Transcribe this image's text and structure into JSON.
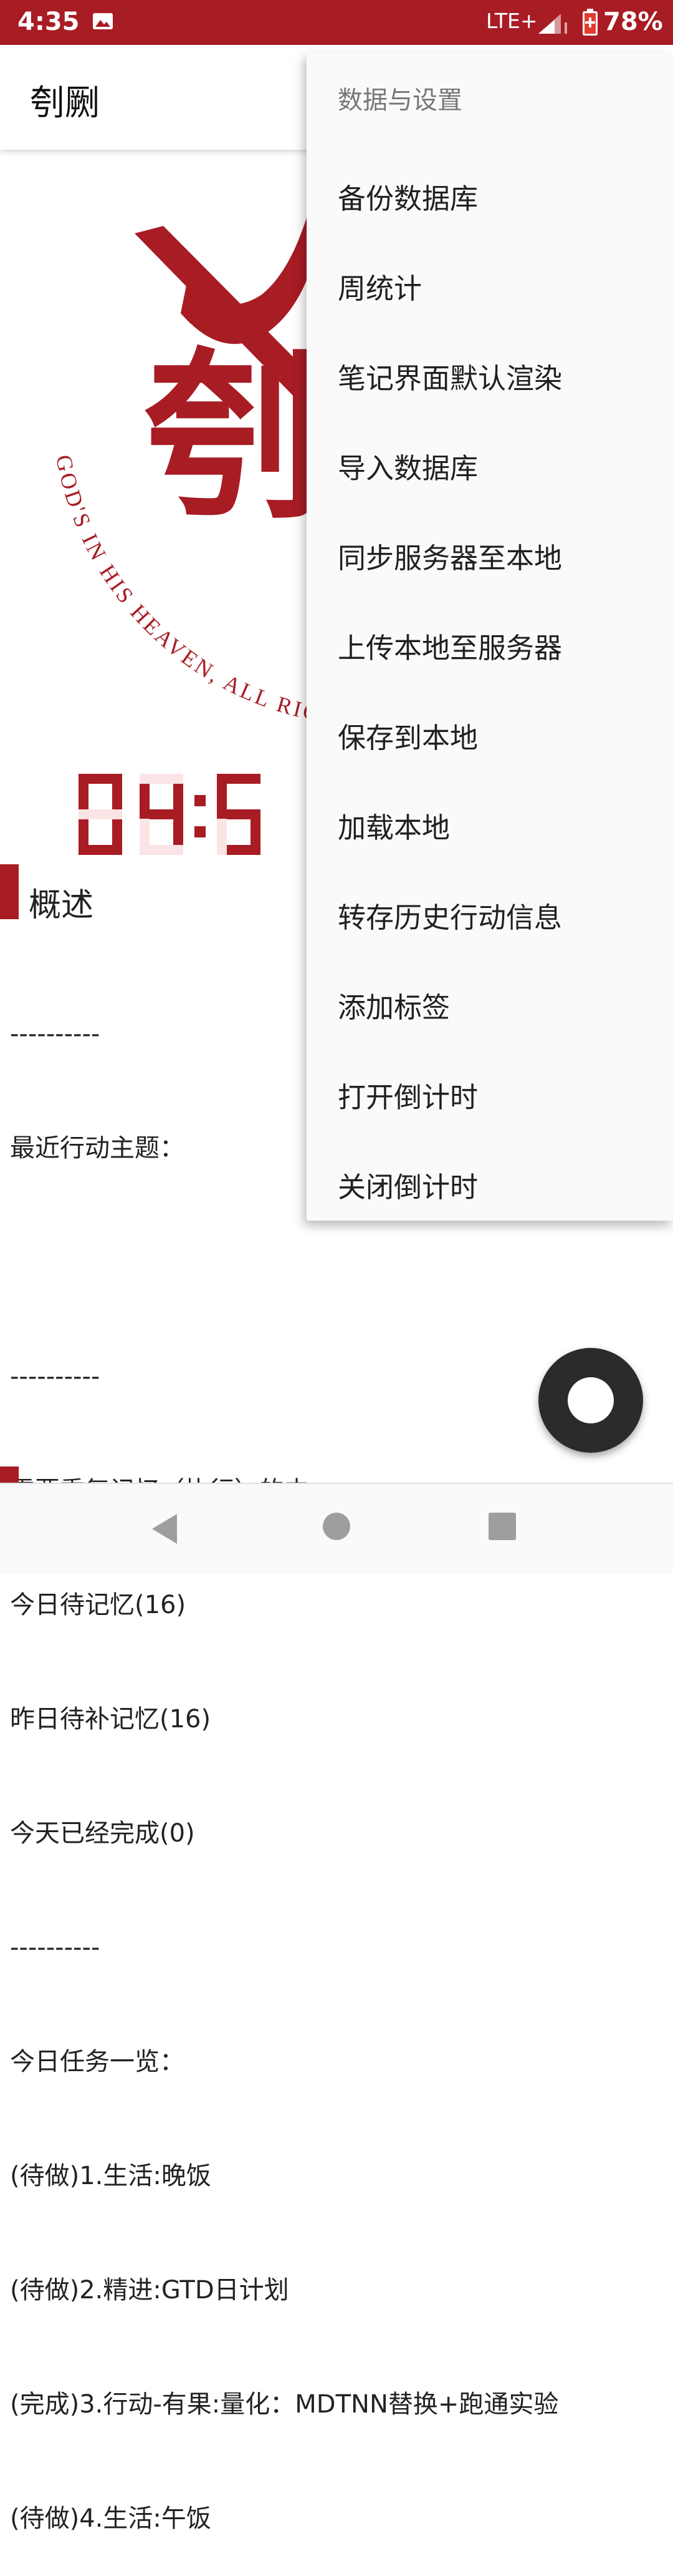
{
  "status_bar": {
    "time": "4:35",
    "network": "LTE+",
    "battery": "78%"
  },
  "app_bar": {
    "title": "刳劂"
  },
  "hero": {
    "logo_char": "刳",
    "arc_text": "GOD'S IN HIS HEAVEN, ALL RIGH",
    "clock_text": "04:5"
  },
  "section": {
    "title": "概述"
  },
  "content_lines": [
    "----------",
    "最近行动主题：",
    "",
    "----------",
    "需要重复记忆（执行）的内",
    "今日待记忆(16)",
    "昨日待补记忆(16)",
    "今天已经完成(0)",
    "----------",
    "今日任务一览：",
    "(待做)1.生活:晚饭",
    "(待做)2.精进:GTD日计划",
    "(完成)3.行动-有果:量化：MDTNN替换+跑通实验",
    "(待做)4.生活:午饭"
  ],
  "menu": {
    "header": "数据与设置",
    "items": [
      "备份数据库",
      "周统计",
      "笔记界面默认渲染",
      "导入数据库",
      "同步服务器至本地",
      "上传本地至服务器",
      "保存到本地",
      "加载本地",
      "转存历史行动信息",
      "添加标签",
      "打开倒计时",
      "关闭倒计时"
    ]
  },
  "colors": {
    "accent": "#a81c24",
    "fab": "#2b2b2b"
  }
}
